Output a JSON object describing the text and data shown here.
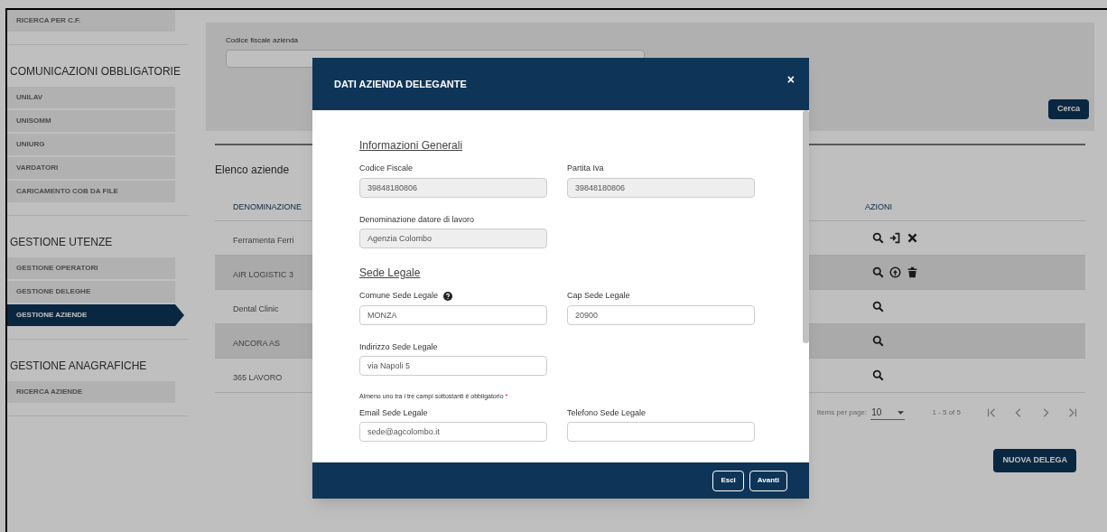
{
  "sidebar": {
    "sections": [
      {
        "items": [
          {
            "label": "RICERCA PER C.F.",
            "selected": false
          }
        ]
      },
      {
        "title": "COMUNICAZIONI OBBLIGATORIE",
        "items": [
          {
            "label": "UNILAV",
            "selected": false
          },
          {
            "label": "UNISOMM",
            "selected": false
          },
          {
            "label": "UNIURG",
            "selected": false
          },
          {
            "label": "VARDATORI",
            "selected": false
          },
          {
            "label": "CARICAMENTO COB DA FILE",
            "selected": false
          }
        ]
      },
      {
        "title": "GESTIONE UTENZE",
        "items": [
          {
            "label": "GESTIONE OPERATORI",
            "selected": false
          },
          {
            "label": "GESTIONE DELEGHE",
            "selected": false
          },
          {
            "label": "GESTIONE AZIENDE",
            "selected": true
          }
        ]
      },
      {
        "title": "GESTIONE ANAGRAFICHE",
        "items": [
          {
            "label": "RICERCA AZIENDE",
            "selected": false
          }
        ]
      }
    ]
  },
  "search": {
    "label": "Codice fiscale azienda",
    "button": "Cerca"
  },
  "list": {
    "title": "Elenco aziende",
    "columns": [
      "DENOMINAZIONE",
      "AZIONI"
    ],
    "rows": [
      {
        "name": "Ferramenta Ferri",
        "actions": [
          {
            "kind": "search"
          },
          {
            "kind": "login"
          },
          {
            "kind": "close"
          }
        ]
      },
      {
        "name": "AIR LOGISTIC 3",
        "actions": [
          {
            "kind": "search"
          },
          {
            "kind": "upload"
          },
          {
            "kind": "delete"
          }
        ]
      },
      {
        "name": "Dental Clinic",
        "actions": [
          {
            "kind": "search"
          }
        ]
      },
      {
        "name": "ANCORA AS",
        "actions": [
          {
            "kind": "search"
          }
        ]
      },
      {
        "name": "365 LAVORO",
        "actions": [
          {
            "kind": "search"
          }
        ]
      }
    ],
    "pagination": {
      "label": "Items per page:",
      "page_size": "10",
      "range": "1 - 5 of 5"
    },
    "button": "NUOVA DELEGA"
  },
  "modal": {
    "title": "DATI AZIENDA DELEGANTE",
    "close": "×",
    "sections": [
      {
        "heading": "Informazioni Generali",
        "rows": [
          [
            {
              "label": "Codice Fiscale",
              "value": "39848180806",
              "disabled": true
            },
            {
              "label": "Partita Iva",
              "value": "39848180806",
              "disabled": true
            }
          ],
          [
            {
              "label": "Denominazione datore di lavoro",
              "value": "Agenzia Colombo",
              "disabled": true
            }
          ]
        ]
      },
      {
        "heading": "Sede Legale",
        "rows": [
          [
            {
              "label": "Comune Sede Legale",
              "value": "MONZA",
              "disabled": false,
              "help": true
            },
            {
              "label": "Cap Sede Legale",
              "value": "20900",
              "disabled": false
            }
          ],
          [
            {
              "label": "Indirizzo Sede Legale",
              "value": "via Napoli 5",
              "disabled": false
            }
          ]
        ]
      },
      {
        "note": "Almeno uno tra i tre campi sottostanti è obbligatorio",
        "required": "*",
        "rows": [
          [
            {
              "label": "Email Sede Legale",
              "value": "sede@agcolombo.it",
              "disabled": false
            },
            {
              "label": "Telefono Sede Legale",
              "disabled": false
            }
          ]
        ]
      }
    ],
    "buttons": [
      "Esci",
      "Avanti"
    ]
  }
}
